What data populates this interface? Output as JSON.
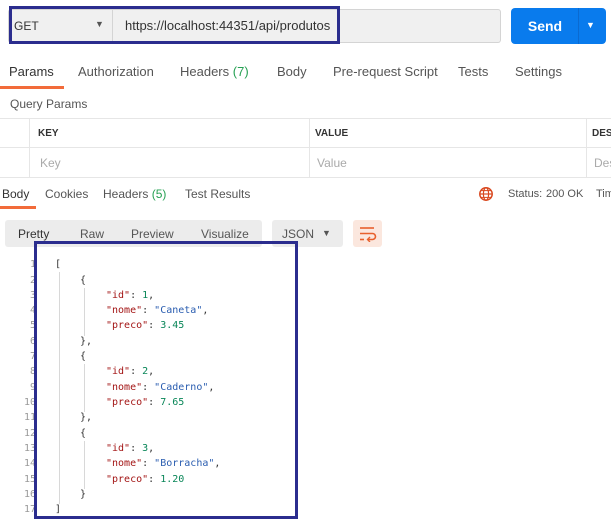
{
  "request": {
    "method": "GET",
    "url": "https://localhost:44351/api/produtos",
    "send_label": "Send"
  },
  "request_tabs": [
    {
      "label": "Params",
      "count": ""
    },
    {
      "label": "Authorization",
      "count": ""
    },
    {
      "label": "Headers",
      "count": "(7)"
    },
    {
      "label": "Body",
      "count": ""
    },
    {
      "label": "Pre-request Script",
      "count": ""
    },
    {
      "label": "Tests",
      "count": ""
    },
    {
      "label": "Settings",
      "count": ""
    }
  ],
  "query_params": {
    "title": "Query Params",
    "headers": [
      "KEY",
      "VALUE",
      "DESC"
    ],
    "placeholders": [
      "Key",
      "Value",
      "Des"
    ]
  },
  "response_tabs": [
    {
      "label": "Body",
      "count": ""
    },
    {
      "label": "Cookies",
      "count": ""
    },
    {
      "label": "Headers",
      "count": "(5)"
    },
    {
      "label": "Test Results",
      "count": ""
    }
  ],
  "status": {
    "label": "Status:",
    "value": "200 OK",
    "time_label": "Tim"
  },
  "view_tabs": [
    "Pretty",
    "Raw",
    "Preview",
    "Visualize"
  ],
  "format": "JSON",
  "line_numbers": [
    "1",
    "2",
    "3",
    "4",
    "5",
    "6",
    "7",
    "8",
    "9",
    "10",
    "11",
    "12",
    "13",
    "14",
    "15",
    "16",
    "17"
  ],
  "code": {
    "open_bracket": "[",
    "close_bracket": "]",
    "open_brace": "{",
    "close_brace": "}",
    "close_brace_comma": "},",
    "items": [
      {
        "id_key": "\"id\"",
        "id_val": "1",
        "nome_key": "\"nome\"",
        "nome_val": "\"Caneta\"",
        "preco_key": "\"preco\"",
        "preco_val": "3.45"
      },
      {
        "id_key": "\"id\"",
        "id_val": "2",
        "nome_key": "\"nome\"",
        "nome_val": "\"Caderno\"",
        "preco_key": "\"preco\"",
        "preco_val": "7.65"
      },
      {
        "id_key": "\"id\"",
        "id_val": "3",
        "nome_key": "\"nome\"",
        "nome_val": "\"Borracha\"",
        "preco_key": "\"preco\"",
        "preco_val": "1.20"
      }
    ]
  },
  "colors": {
    "accent": "#f26b3a",
    "send": "#097bed",
    "status_ok": "#26a053",
    "highlight": "#2b2d8e"
  }
}
